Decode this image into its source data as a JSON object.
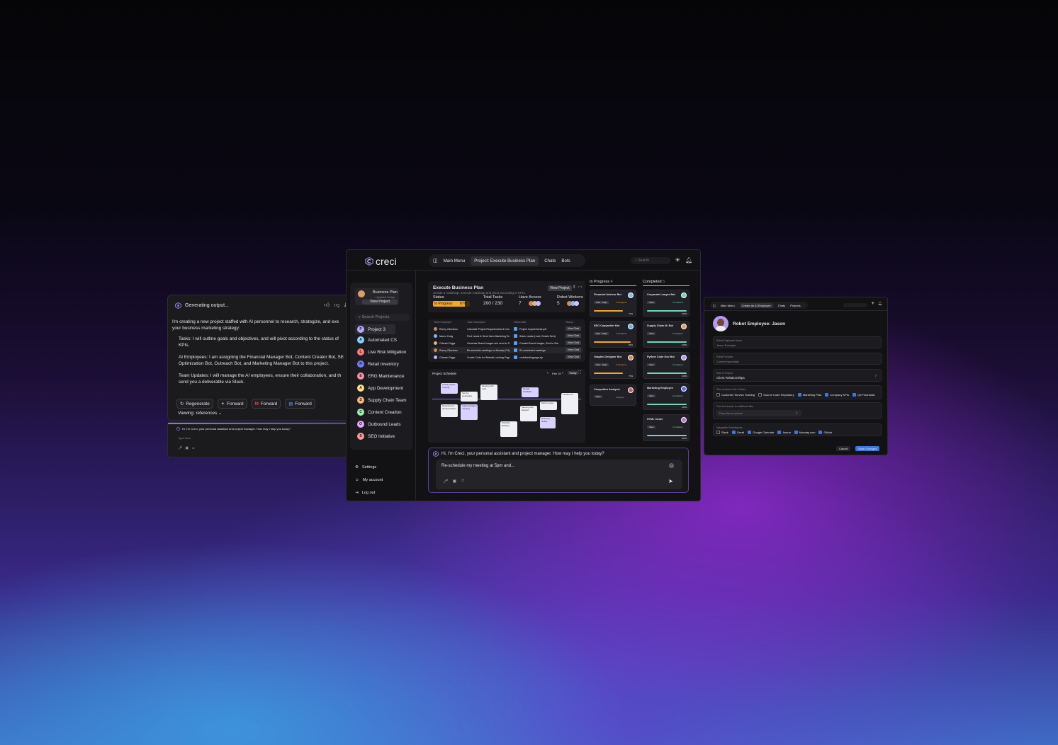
{
  "chat_panel": {
    "status": "Generating output...",
    "intro_line1": "I'm creating a new project staffed with AI personnel to research, strategize, and exe",
    "intro_line2": "your business marketing strategy:",
    "bullets": [
      {
        "l1": "Tasks: I will outline goals and objectives, and will pivot according to the status of",
        "l2": "KPIs."
      },
      {
        "l1": "AI Employees: I am assigning the Financial Manager Bot, Content Creator Bot, SE",
        "l2": "Optimization Bot, Outreach Bot, and Marketing Manager Bot to this project."
      },
      {
        "l1": "Team Updates: I will manage the AI employees, ensure their collaboration, and th",
        "l2": "send you a deliverable via Slack."
      }
    ],
    "actions": [
      "Regenerate",
      "Forward",
      "Forward",
      "Forward"
    ],
    "viewing_label": "Viewing:",
    "viewing_value": "references",
    "mini_greeting": "Hi, I'm Creci, your personal assistant and project manager. How may I help you today?",
    "mini_placeholder": "Type here..."
  },
  "main": {
    "logo": "creci",
    "nav": {
      "menu": "Main Menu",
      "project": "Project: Execute Business Plan",
      "chats": "Chats",
      "bots": "Bots"
    },
    "search_placeholder": "Search",
    "business_card": {
      "title": "Business Plan",
      "subtitle": "Updated Today",
      "button": "View Project"
    },
    "search_projects": "Search Projects",
    "projects": [
      {
        "letter": "P",
        "name": "Project 3",
        "color": "#b9a6ff"
      },
      {
        "letter": "A",
        "name": "Automated CS",
        "color": "#8fd0ff"
      },
      {
        "letter": "L",
        "name": "Live Risk Mitigation",
        "color": "#ff7a7a"
      },
      {
        "letter": "R",
        "name": "Retail Inventory",
        "color": "#6f7cff"
      },
      {
        "letter": "E",
        "name": "ERG Maintenance",
        "color": "#ff8fa3"
      },
      {
        "letter": "A",
        "name": "App Development",
        "color": "#ffe08a"
      },
      {
        "letter": "S",
        "name": "Supply Chain Team",
        "color": "#ffb37a"
      },
      {
        "letter": "C",
        "name": "Content Creation",
        "color": "#9ff0b0"
      },
      {
        "letter": "O",
        "name": "Outbound Leads",
        "color": "#e4a8ff"
      },
      {
        "letter": "S",
        "name": "SEO Initiative",
        "color": "#ff9a9a"
      }
    ],
    "footer": [
      "Settings",
      "My account",
      "Log out"
    ],
    "plan": {
      "title": "Execute Business Plan",
      "desc": "Create a roadmap, execute roadmap and pivot according to KPIs.",
      "view_button": "View Project",
      "status_label": "Status",
      "status_value": "In Progress",
      "status_pct": "87%",
      "tasks_label": "Total Tasks",
      "tasks_value": "200 / 230",
      "access_label": "Have Access",
      "access_value": "7",
      "workers_label": "Robot Workers",
      "workers_value": "5",
      "progress": 0.87
    },
    "table": {
      "headers": [
        "Team Employee",
        "Task Description",
        "Deliverable",
        "History"
      ],
      "rows": [
        {
          "name": "Ronny Okonkwo",
          "task": "Calculate Project Requirements & Cost",
          "deliv": "Project requirements.pdf",
          "btn": "View Chat"
        },
        {
          "name": "Marco Craig",
          "task": "Find Leads & Send them Marketing Emails",
          "deliv": "Sales Leads (Lead, Emails Sent)",
          "btn": "View Chat"
        },
        {
          "name": "Orlando Diggs",
          "task": "Generate Brand Images and send to Slack",
          "deliv": "Created Brand Images, Sent to Slack",
          "btn": "View Chat"
        },
        {
          "name": "Ronny Okonkwo",
          "task": "Re-schedule meetings on Monday 2-5pm",
          "deliv": "Re-scheduled meetings",
          "btn": "View Chat"
        },
        {
          "name": "Orlando Diggs",
          "task": "Create Code for Website Landing Page",
          "deliv": "code/landingpage.zip",
          "btn": "View Chat"
        }
      ]
    },
    "schedule": {
      "title": "Project Schedule",
      "month": "Feb 15",
      "today": "Today",
      "events": [
        "Check project scoping",
        "Set the workspace",
        "Meeting with Josh",
        "Design feedback",
        "Finalize UX",
        "Requirement documentation",
        "Implementation meeting",
        "Meeting with Eduard",
        "Sprint review",
        "Directory facility",
        "Prioritize Backlog"
      ]
    },
    "chat": {
      "greeting": "Hi, I'm Creci, your personal assistant and project manager. How may I help you today?",
      "input": "Re-schedule my meeting at 5pm and..."
    }
  },
  "kanban": {
    "in_progress_title": "In Progress",
    "in_progress_count": "4",
    "completed_title": "Completed",
    "completed_count": "5",
    "in_progress": [
      {
        "title": "Financial Advisor Bot",
        "status": "In Progress",
        "pct": "73%",
        "progress": 0.73
      },
      {
        "title": "SEO Copywriter Bot",
        "status": "In Progress",
        "pct": "93%",
        "progress": 0.93
      },
      {
        "title": "Graphic Designer Bot",
        "status": "In Progress",
        "pct": "73%",
        "progress": 0.73
      },
      {
        "title": "Competitor Analysis",
        "status": "Stopped",
        "pct": "",
        "progress": 0.0
      }
    ],
    "completed": [
      {
        "title": "Corporate Lawyer Bot",
        "status": "Completed",
        "pct": "100%"
      },
      {
        "title": "Supply Chain M. Bot",
        "status": "Completed",
        "pct": "100%"
      },
      {
        "title": "Python Code Dev Bot",
        "status": "Completed",
        "pct": "100%"
      },
      {
        "title": "Marketing Employee",
        "status": "Completed",
        "pct": "100%"
      },
      {
        "title": "HTML Coder",
        "status": "Completed",
        "pct": "100%"
      }
    ],
    "view_btn": "View",
    "stop_btn": "Stop"
  },
  "employee": {
    "nav": {
      "menu": "Main Menu",
      "create": "Create an AI Employee",
      "chats": "Chats",
      "projects": "Projects"
    },
    "title": "Robot Employee: Jason",
    "name_label": "Robot Employee Name",
    "name_value": "Jason Example",
    "purpose_label": "Robot Purpose",
    "purpose_value": "Content specialist",
    "role_label": "Role in Project",
    "role_value": "Client Relationships",
    "access_label": "Give access to the Folders",
    "folders": [
      {
        "name": "Customer Service Training",
        "checked": false
      },
      {
        "name": "Source Code Repository",
        "checked": false
      },
      {
        "name": "Marketing Plan",
        "checked": true
      },
      {
        "name": "Company KPIs",
        "checked": true
      },
      {
        "name": "Q3 Financials",
        "checked": true
      }
    ],
    "upload_label": "Give bot access to additional files",
    "upload_placeholder": "Drop files to upload",
    "integrations_label": "Integration Permissions",
    "integrations": [
      {
        "name": "Slack",
        "checked": false
      },
      {
        "name": "Gmail",
        "checked": true
      },
      {
        "name": "Google Calendar",
        "checked": true
      },
      {
        "name": "Asana",
        "checked": true
      },
      {
        "name": "Monday.com",
        "checked": true
      },
      {
        "name": "Github",
        "checked": true
      }
    ],
    "cancel": "Cancel",
    "save": "Save Changes"
  },
  "colors": {
    "accent": "#3a78e0",
    "progress": "#f5a623",
    "completed": "#6fd8b0",
    "purple": "#8a63d2"
  }
}
